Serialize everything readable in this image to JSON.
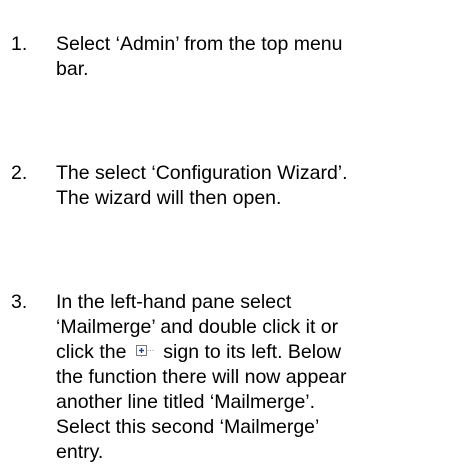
{
  "steps": [
    {
      "number": "1.",
      "lines": [
        "Select ‘Admin’ from the top menu",
        "bar."
      ]
    },
    {
      "number": "2.",
      "lines": [
        "The select ‘Configuration Wizard’.",
        "The wizard will then open."
      ]
    },
    {
      "number": "3.",
      "lines": [
        "In the left-hand pane select",
        "‘Mailmerge’ and double click it or",
        "click the",
        "sign to its left. Below",
        "the function there will now appear",
        "another line titled ‘Mailmerge’.",
        "Select this second ‘Mailmerge’",
        "entry."
      ],
      "icon": "tree-expand-plus-icon"
    }
  ]
}
